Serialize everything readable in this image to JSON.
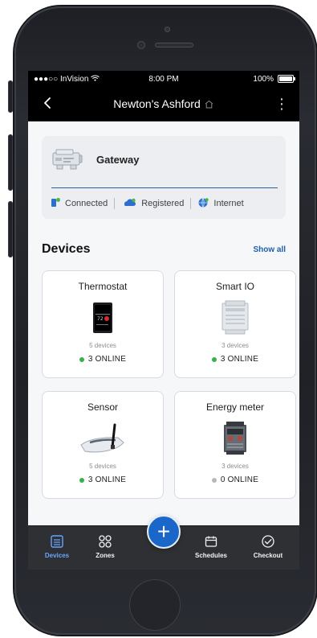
{
  "colors": {
    "brand": "#1b67c9",
    "accent": "#1c5fa8",
    "online": "#35b34a",
    "offline": "#b9b9b9",
    "nav_active": "#67a5ff"
  },
  "status_bar": {
    "carrier": "●●●○○ InVision",
    "time": "8:00 PM",
    "battery": "100%"
  },
  "header": {
    "title": "Newton's Ashford"
  },
  "gateway": {
    "title": "Gateway",
    "statuses": [
      {
        "label": "Connected",
        "icon": "connected-icon"
      },
      {
        "label": "Registered",
        "icon": "cloud-icon"
      },
      {
        "label": "Internet",
        "icon": "globe-icon"
      }
    ]
  },
  "devices": {
    "title": "Devices",
    "show_all": "Show all",
    "items": [
      {
        "name": "Thermostat",
        "count": "5 devices",
        "status": "3 ONLINE",
        "state": "online",
        "icon": "thermostat-icon"
      },
      {
        "name": "Smart IO",
        "count": "3 devices",
        "status": "3 ONLINE",
        "state": "online",
        "icon": "smart-io-icon"
      },
      {
        "name": "Sensor",
        "count": "5 devices",
        "status": "3 ONLINE",
        "state": "online",
        "icon": "sensor-icon"
      },
      {
        "name": "Energy meter",
        "count": "3 devices",
        "status": "0 ONLINE",
        "state": "offline",
        "icon": "energy-meter-icon"
      }
    ]
  },
  "bottom_nav": {
    "items": [
      {
        "label": "Devices",
        "icon": "devices-icon",
        "active": true
      },
      {
        "label": "Zones",
        "icon": "zones-icon",
        "active": false
      },
      {
        "label": "Schedules",
        "icon": "schedules-icon",
        "active": false
      },
      {
        "label": "Checkout",
        "icon": "checkout-icon",
        "active": false
      }
    ],
    "fab_label": "+"
  }
}
